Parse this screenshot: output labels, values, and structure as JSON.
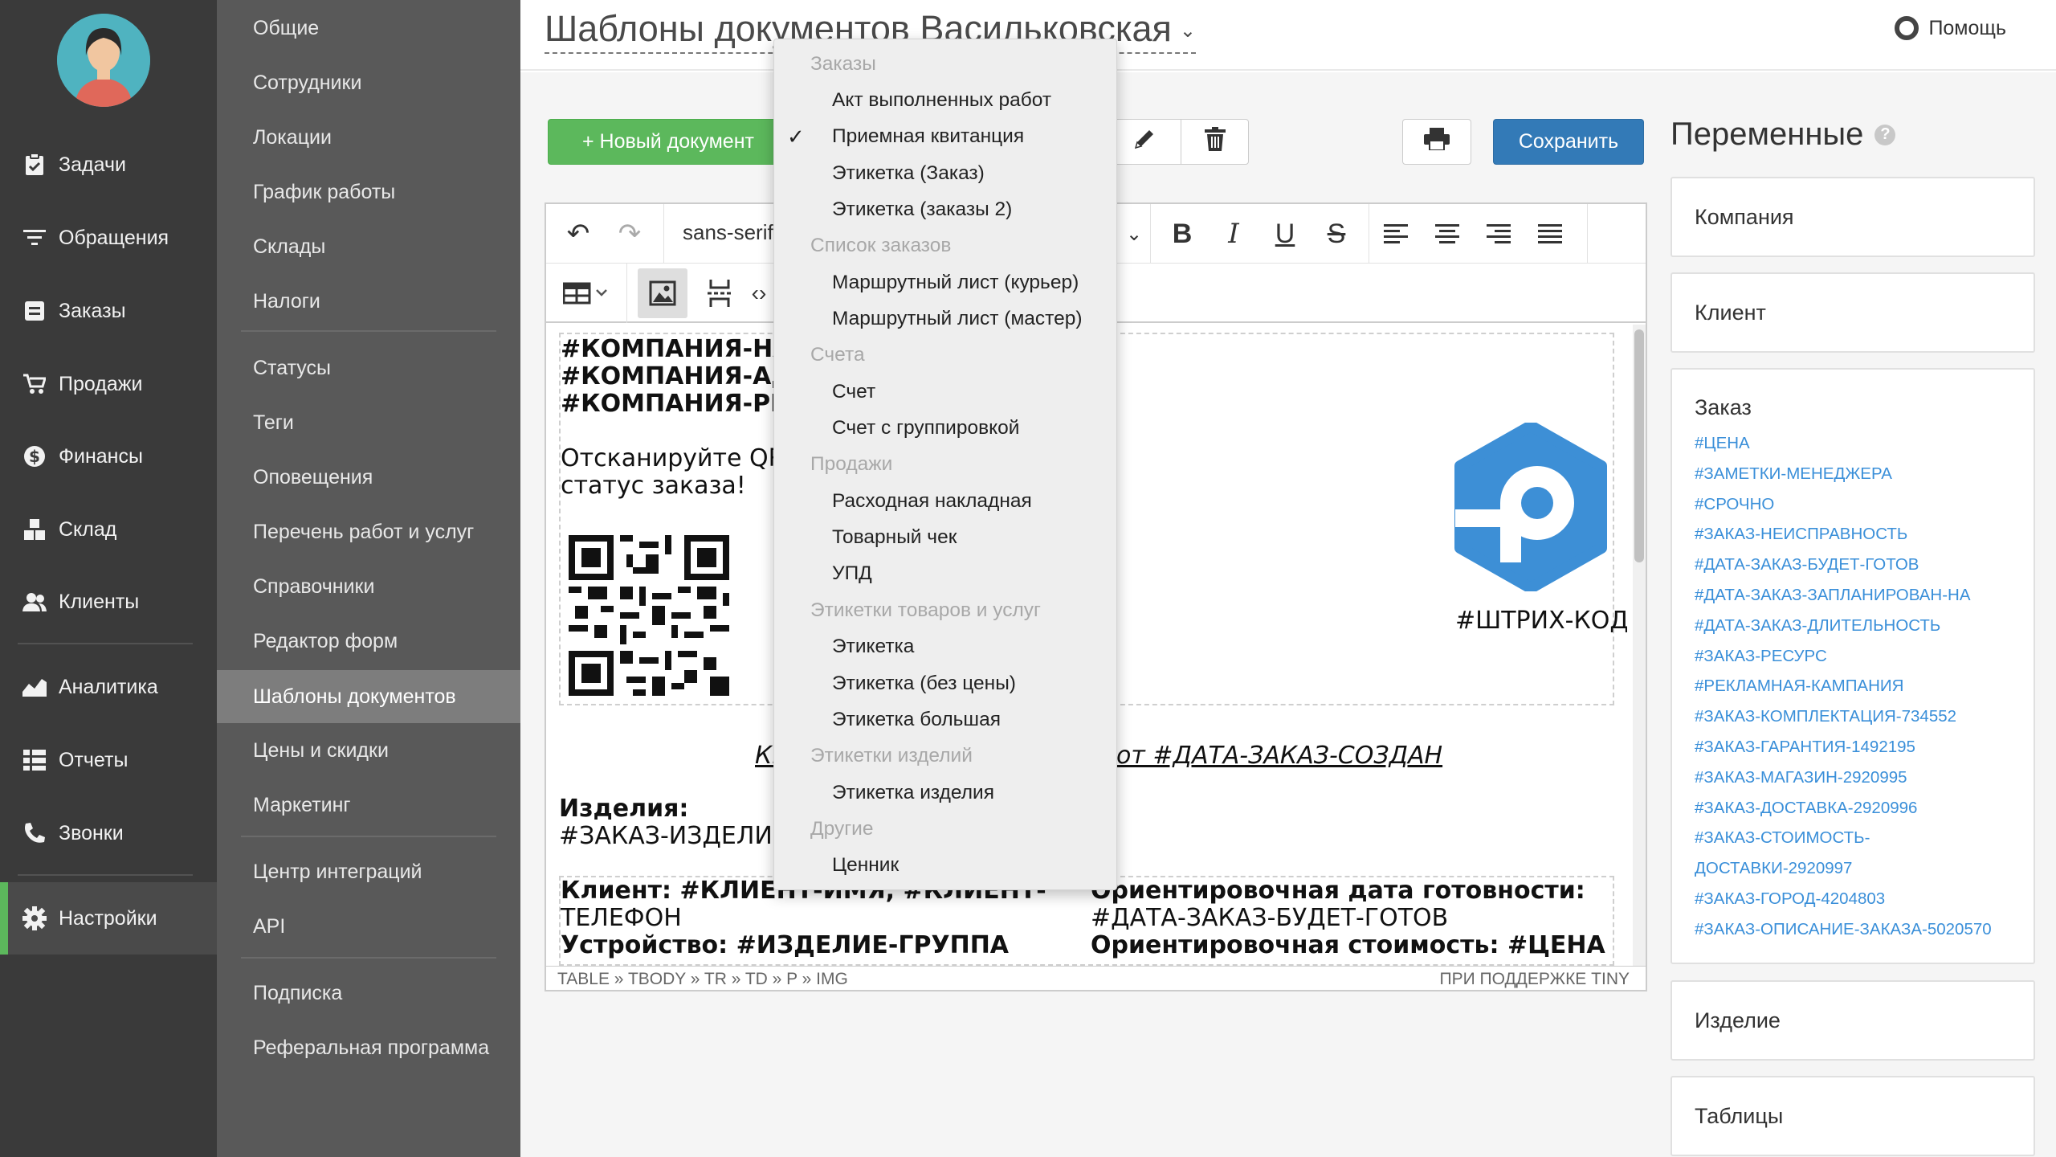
{
  "nav": {
    "items": [
      {
        "label": "Задачи",
        "icon": "clipboard-icon"
      },
      {
        "label": "Обращения",
        "icon": "filter-icon"
      },
      {
        "label": "Заказы",
        "icon": "order-icon"
      },
      {
        "label": "Продажи",
        "icon": "cart-icon"
      },
      {
        "label": "Финансы",
        "icon": "dollar-icon"
      },
      {
        "label": "Склад",
        "icon": "boxes-icon"
      },
      {
        "label": "Клиенты",
        "icon": "users-icon"
      },
      {
        "label": "Аналитика",
        "icon": "chart-icon"
      },
      {
        "label": "Отчеты",
        "icon": "list-icon"
      },
      {
        "label": "Звонки",
        "icon": "phone-icon"
      },
      {
        "label": "Настройки",
        "icon": "gear-icon"
      }
    ],
    "active": "Настройки"
  },
  "sub": {
    "items": [
      "Общие",
      "Сотрудники",
      "Локации",
      "График работы",
      "Склады",
      "Налоги",
      "Статусы",
      "Теги",
      "Оповещения",
      "Перечень работ и услуг",
      "Справочники",
      "Редактор форм",
      "Шаблоны документов",
      "Цены и скидки",
      "Маркетинг",
      "Центр интеграций",
      "API",
      "Подписка",
      "Реферальная программа"
    ],
    "active": "Шаблоны документов"
  },
  "header": {
    "title": "Шаблоны документов Васильковская",
    "help": "Помощь"
  },
  "toolbar": {
    "new_doc": "+ Новый документ",
    "save": "Сохранить"
  },
  "editor": {
    "font_family": "sans-serif",
    "status_path": "TABLE » TBODY » TR » TD » P » IMG",
    "powered": "ПРИ ПОДДЕРЖКЕ TINY",
    "doc": {
      "line1": "#КОМПАНИЯ-НАЗ",
      "line2": "#КОМПАНИЯ-АДР",
      "line3": "#КОМПАНИЯ-РЕК",
      "scan1": "Отсканируйте QR-",
      "scan2": "статус заказа!",
      "barcode": "#ШТРИХ-КОД",
      "receipt_left": "Кв",
      "receipt_right": "от #ДАТА-ЗАКАЗ-СОЗДАН",
      "items_label": "Изделия:",
      "items_value": "#ЗАКАЗ-ИЗДЕЛИЕ",
      "client1": "Клиент: #КЛИЕНТ-ИМЯ, #КЛИЕНТ-",
      "client2": "ТЕЛЕФОН",
      "device": "Устройство: #ИЗДЕЛИЕ-ГРУППА",
      "ready1": "Ориентировочная дата готовности:",
      "ready2": "#ДАТА-ЗАКАЗ-БУДЕТ-ГОТОВ",
      "cost": "Ориентировочная стоимость: #ЦЕНА"
    }
  },
  "variables": {
    "title": "Переменные",
    "company": "Компания",
    "client": "Клиент",
    "order": "Заказ",
    "order_links": [
      "#ЦЕНА",
      "#ЗАМЕТКИ-МЕНЕДЖЕРА",
      "#СРОЧНО",
      "#ЗАКАЗ-НЕИСПРАВНОСТЬ",
      "#ДАТА-ЗАКАЗ-БУДЕТ-ГОТОВ",
      "#ДАТА-ЗАКАЗ-ЗАПЛАНИРОВАН-НА",
      "#ДАТА-ЗАКАЗ-ДЛИТЕЛЬНОСТЬ",
      "#ЗАКАЗ-РЕСУРС",
      "#РЕКЛАМНАЯ-КАМПАНИЯ",
      "#ЗАКАЗ-КОМПЛЕКТАЦИЯ-734552",
      "#ЗАКАЗ-ГАРАНТИЯ-1492195",
      "#ЗАКАЗ-МАГАЗИН-2920995",
      "#ЗАКАЗ-ДОСТАВКА-2920996",
      "#ЗАКАЗ-СТОИМОСТЬ-",
      "ДОСТАВКИ-2920997",
      "#ЗАКАЗ-ГОРОД-4204803",
      "#ЗАКАЗ-ОПИСАНИЕ-ЗАКАЗА-5020570"
    ],
    "product": "Изделие",
    "tables": "Таблицы"
  },
  "dropdown": {
    "rows": [
      {
        "type": "group",
        "label": "Заказы"
      },
      {
        "type": "option",
        "label": "Акт выполненных работ"
      },
      {
        "type": "option",
        "label": "Приемная квитанция",
        "selected": true
      },
      {
        "type": "option",
        "label": "Этикетка (Заказ)"
      },
      {
        "type": "option",
        "label": "Этикетка (заказы 2)"
      },
      {
        "type": "group",
        "label": "Список заказов"
      },
      {
        "type": "option",
        "label": "Маршрутный лист (курьер)"
      },
      {
        "type": "option",
        "label": "Маршрутный лист (мастер)"
      },
      {
        "type": "group",
        "label": "Счета"
      },
      {
        "type": "option",
        "label": "Счет"
      },
      {
        "type": "option",
        "label": "Счет с группировкой"
      },
      {
        "type": "group",
        "label": "Продажи"
      },
      {
        "type": "option",
        "label": "Расходная накладная"
      },
      {
        "type": "option",
        "label": "Товарный чек"
      },
      {
        "type": "option",
        "label": "УПД"
      },
      {
        "type": "group",
        "label": "Этикетки товаров и услуг"
      },
      {
        "type": "option",
        "label": "Этикетка"
      },
      {
        "type": "option",
        "label": "Этикетка (без цены)"
      },
      {
        "type": "option",
        "label": "Этикетка большая"
      },
      {
        "type": "group",
        "label": "Этикетки изделий"
      },
      {
        "type": "option",
        "label": "Этикетка изделия"
      },
      {
        "type": "group",
        "label": "Другие"
      },
      {
        "type": "option",
        "label": "Ценник"
      }
    ]
  },
  "colors": {
    "nav_bg": "#3a3a3a",
    "sub_bg": "#595959",
    "green": "#5cb85c",
    "blue": "#337ab7",
    "link": "#3a8fd9",
    "logo": "#3d8fd6"
  }
}
